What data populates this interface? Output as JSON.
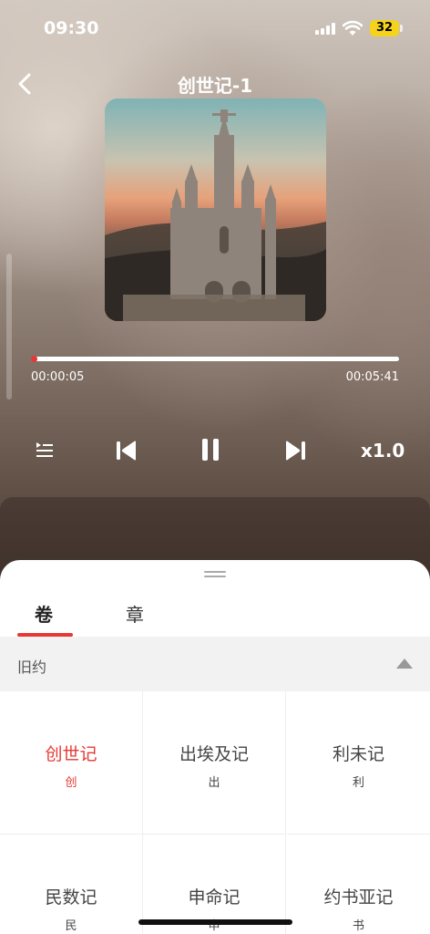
{
  "status_bar": {
    "time": "09:30",
    "battery": "32"
  },
  "header": {
    "title": "创世记-1"
  },
  "player": {
    "current_time": "00:00:05",
    "total_time": "00:05:41",
    "progress": 0.015,
    "speed": "x1.0"
  },
  "sheet": {
    "tabs": [
      {
        "label": "卷",
        "active": true
      },
      {
        "label": "章",
        "active": false
      }
    ],
    "section": {
      "label": "旧约"
    },
    "books": [
      {
        "name": "创世记",
        "abbr": "创",
        "active": true
      },
      {
        "name": "出埃及记",
        "abbr": "出",
        "active": false
      },
      {
        "name": "利未记",
        "abbr": "利",
        "active": false
      },
      {
        "name": "民数记",
        "abbr": "民",
        "active": false
      },
      {
        "name": "申命记",
        "abbr": "申",
        "active": false
      },
      {
        "name": "约书亚记",
        "abbr": "书",
        "active": false
      }
    ]
  },
  "colors": {
    "accent": "#e53935",
    "battery": "#f5d21b"
  },
  "icons": [
    "back-arrow-icon",
    "playlist-icon",
    "previous-icon",
    "pause-icon",
    "next-icon",
    "wifi-icon",
    "signal-icon",
    "battery-icon",
    "collapse-arrow-icon"
  ]
}
